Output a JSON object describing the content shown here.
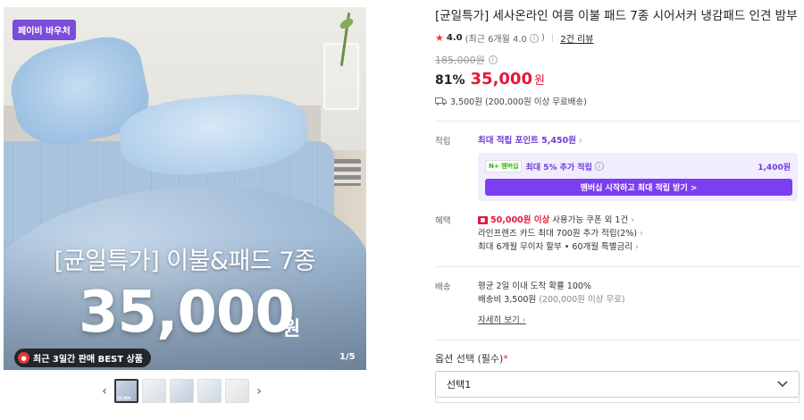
{
  "gallery": {
    "badge": "페이비 바우처",
    "hero_title": "[균일특가] 이불&패드 7종",
    "hero_price": "35,000",
    "hero_won": "원",
    "best_label": "최근 3일간 판매 BEST 상품",
    "counter": "1/5",
    "prev_arrow": "‹",
    "next_arrow": "›",
    "thumb_caption": "35,000"
  },
  "product": {
    "title": "[균일특가] 세사온라인 여름 이불 패드 7종 시어서커 냉감패드 인견 밤부",
    "rating": "4.0",
    "rating_detail": "(최근 6개월 4.0",
    "rating_detail_end": ")",
    "review_link": "2건 리뷰",
    "original_price": "185,000원",
    "discount": "81%",
    "price": "35,000",
    "price_unit": "원",
    "shipping": "3,500원 (200,000원 이상 무료배송)"
  },
  "points": {
    "label": "적립",
    "max_point": "최대 적립 포인트 5,450원",
    "membership_logo": "N+ 멤버십",
    "membership_text": "최대 5% 추가 적립",
    "membership_amount": "1,400원",
    "membership_button": "멤버십 시작하고 최대 적립 받기 >"
  },
  "benefits": {
    "label": "혜택",
    "coupon_bold": "50,000원 이상",
    "coupon_rest": "사용가능 쿠폰 외 1건",
    "card": "라인프렌즈 카드 최대 700원 추가 적립(2%)",
    "installment": "최대 6개월 무이자 할부 • 60개월 특별금리"
  },
  "delivery": {
    "label": "배송",
    "arrival": "평균 2일 이내 도착 확률 100%",
    "fee": "배송비 3,500원",
    "fee_note": "(200,000원 이상 무료)",
    "detail_link": "자세히 보기"
  },
  "options": {
    "label": "옵션 선택 (필수)",
    "required_mark": "*",
    "selected": "선택1"
  },
  "colors": {
    "accent_purple": "#7b3ff2",
    "price_red": "#e5173c"
  }
}
